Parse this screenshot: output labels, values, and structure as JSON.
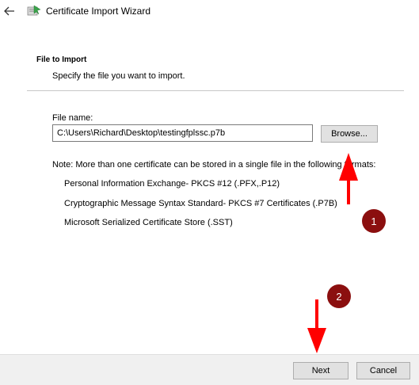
{
  "window": {
    "title": "Certificate Import Wizard",
    "back_icon": "back-arrow-icon",
    "app_icon": "certificate-icon"
  },
  "page": {
    "heading": "File to Import",
    "description": "Specify the file you want to import."
  },
  "file": {
    "label": "File name:",
    "value": "C:\\Users\\Richard\\Desktop\\testingfplssc.p7b",
    "browse_label": "Browse..."
  },
  "formats": {
    "note": "Note:  More than one certificate can be stored in a single file in the following formats:",
    "items": [
      "Personal Information Exchange- PKCS #12 (.PFX,.P12)",
      "Cryptographic Message Syntax Standard- PKCS #7 Certificates (.P7B)",
      "Microsoft Serialized Certificate Store (.SST)"
    ]
  },
  "buttons": {
    "next": "Next",
    "cancel": "Cancel"
  },
  "annotations": {
    "badge1": "1",
    "badge2": "2",
    "arrow_color": "#ff0000",
    "badge_color": "#8b0f0f"
  }
}
